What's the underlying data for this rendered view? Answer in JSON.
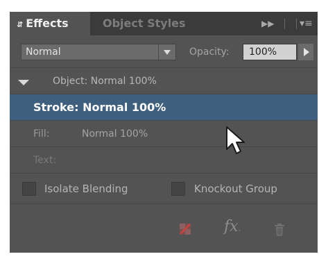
{
  "tabs": {
    "effects_label": "Effects",
    "object_styles_label": "Object Styles"
  },
  "blend": {
    "mode": "Normal",
    "opacity_label": "Opacity:",
    "opacity_value": "100%"
  },
  "list": {
    "object_label": "Object: Normal 100%",
    "stroke_label": "Stroke: Normal 100%",
    "fill_label": "Fill:",
    "fill_value": "Normal 100%",
    "text_label": "Text:"
  },
  "options": {
    "isolate_label": "Isolate Blending",
    "isolate_checked": false,
    "knockout_label": "Knockout Group",
    "knockout_checked": false
  },
  "icons": {
    "fx_label": "fx"
  },
  "colors": {
    "panel_bg": "#535353",
    "tabbar_bg": "#3b3b3b",
    "selected_row": "#3e5f7d"
  }
}
